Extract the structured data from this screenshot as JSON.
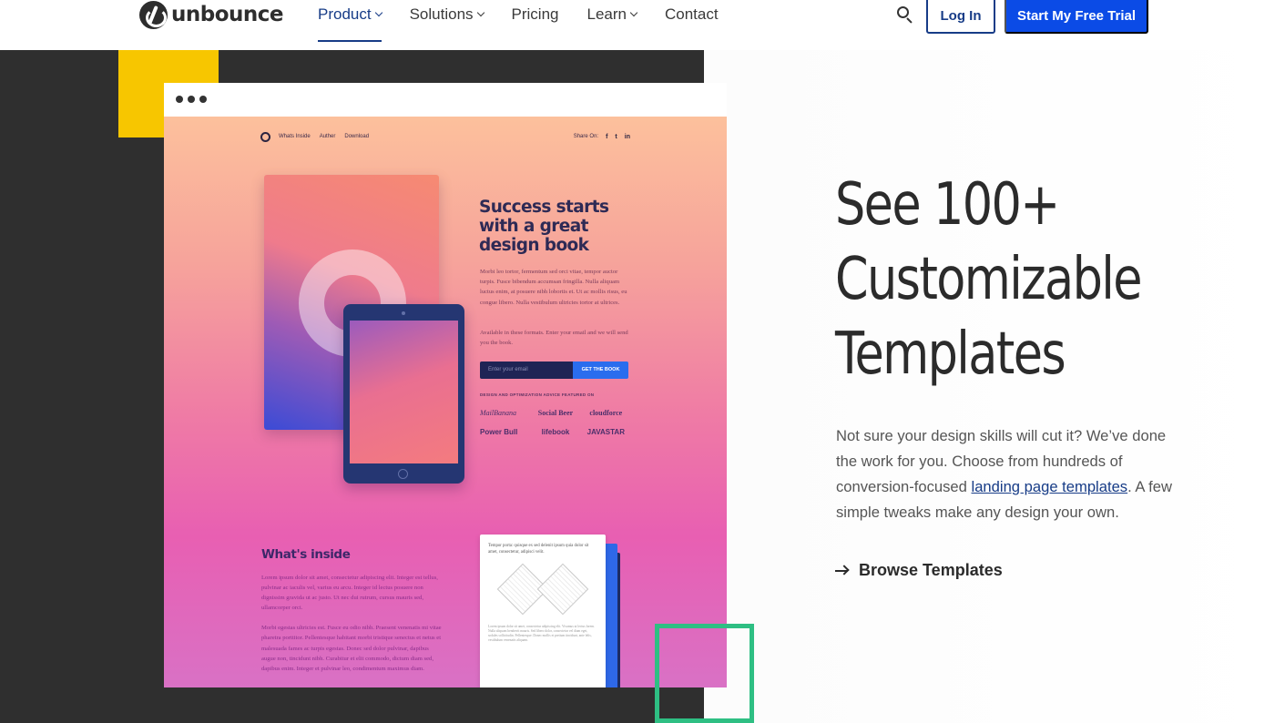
{
  "header": {
    "logo_text": "unbounce",
    "nav": [
      {
        "label": "Product",
        "has_dropdown": true,
        "active": true
      },
      {
        "label": "Solutions",
        "has_dropdown": true,
        "active": false
      },
      {
        "label": "Pricing",
        "has_dropdown": false,
        "active": false
      },
      {
        "label": "Learn",
        "has_dropdown": true,
        "active": false
      },
      {
        "label": "Contact",
        "has_dropdown": false,
        "active": false
      }
    ],
    "search_icon": "search-icon",
    "login_label": "Log In",
    "trial_label": "Start My Free Trial"
  },
  "colors": {
    "brand_blue": "#0b4be6",
    "nav_active": "#173c87",
    "accent_yellow": "#f7c600",
    "accent_green": "#2ebf83",
    "dark_panel": "#2f2f2f"
  },
  "preview": {
    "mini_nav": {
      "links": [
        "Whats Inside",
        "Auther",
        "Download"
      ],
      "share_label": "Share On:",
      "share_icons": [
        "f",
        "t",
        "in"
      ]
    },
    "hero_title": "Success starts with a great design book",
    "hero_body": "Morbi leo tortor, fermentum sed orci vitae, tempor auctor turpis. Fusce bibendum accumsan fringilla. Nulla aliquam luctus enim, at posuere nibh lobortis et. Ut ac mollis risus, eu congue libero. Nulla vestibulum ultricies tortor at ultrices.",
    "hero_body2": "Available in these formats. Enter your email and we will send you the book.",
    "email_placeholder": "Enter your email",
    "cta_label": "GET THE BOOK",
    "featured_label": "DESIGN AND OPTIMIZATION ADVICE FEATURED ON",
    "brands": [
      "MailBanana",
      "Social Beer",
      "cloudforce",
      "Power Bull",
      "lifebook",
      "JAVASTAR"
    ],
    "inside_title": "What's inside",
    "inside_paragraphs": [
      "Lorem ipsum dolor sit amet, consectetur adipiscing elit. Integer est tellus, pulvinar ac iaculis vel, varius eu arcu. Integer id lectus posuere non dignissim gravida ut ac justo. Ut nec dui rutrum, cursus mauris sed, ullamcorper orci.",
      "Morbi egestas ultricies est. Fusce eu odio nibh. Praesent venenatis mi vitae pharetra porttitor. Pellentesque habitant morbi tristique senectus et netus et malesuada fames ac turpis egestas. Donec sed dolor pulvinar, dapibus augue non, tincidunt nibh. Curabitur et elit commodo, dictum diam sed, dapibus enim. Integer et pulvinar leo, condimentum maximus diam."
    ],
    "doc_title": "Tempor porta: quisque ex sed delenit ipsum quia dolor sit amet, consectetur, adipisci velit.",
    "doc_lines": "Lorem ipsum dolor sit amet, consectetur adipiscing elit. Vivamus ut lectus lorem. Nulla aliquam hendrerit mauris. Sed libero dolor, consectetur vel diam eget, sodales sollicitudin. Pellentesque. Donec mollis et pretium tincidunt, ante felis, vestibulum venenatis aliquam."
  },
  "main": {
    "headline": "See 100+ Customizable Templates",
    "desc_before": "Not sure your design skills will cut it? We’ve done the work for you. Choose from hundreds of conversion-focused ",
    "desc_link": "landing page templates",
    "desc_after": ". A few simple tweaks make any design your own.",
    "browse_label": "Browse Templates",
    "browse_icon": "arrow-right-icon"
  }
}
